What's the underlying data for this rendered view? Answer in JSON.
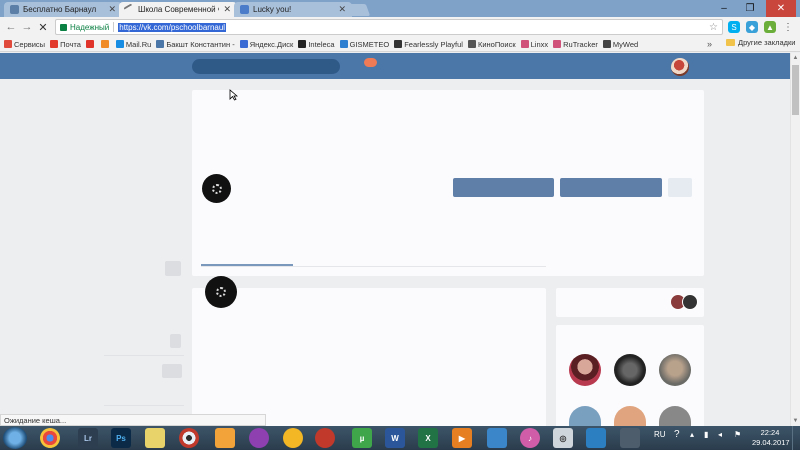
{
  "browser": {
    "tabs": [
      {
        "label": "Бесплатно Барнаул",
        "active": false
      },
      {
        "label": "Школа Современной Ф",
        "active": true
      },
      {
        "label": "Lucky you!",
        "active": false
      }
    ],
    "secure_label": "Надежный",
    "url": "https://vk.com/pschoolbarnaul",
    "bookmarks": [
      {
        "label": "Сервисы",
        "color": "#e04a3c"
      },
      {
        "label": "Почта",
        "color": "#e23b2e"
      },
      {
        "label": "",
        "color": "#e0342a"
      },
      {
        "label": "",
        "color": "#f08a24"
      },
      {
        "label": "Mail.Ru",
        "color": "#168de2"
      },
      {
        "label": "Бакшт Константин -",
        "color": "#4a76a8"
      },
      {
        "label": "Яндекс.Диск",
        "color": "#3a6bd5"
      },
      {
        "label": "Inteleca",
        "color": "#222222"
      },
      {
        "label": "GISMETEO",
        "color": "#2f7fd0"
      },
      {
        "label": "Fearlessly Playful",
        "color": "#333333"
      },
      {
        "label": "КиноПоиск",
        "color": "#555555"
      },
      {
        "label": "Linxx",
        "color": "#d0527a"
      },
      {
        "label": "RuTracker",
        "color": "#d0527a"
      },
      {
        "label": "MyWed",
        "color": "#444444"
      }
    ],
    "bookmarks_overflow": "»",
    "other_bookmarks": "Другие закладки",
    "status_text": "Ожидание кеша..."
  },
  "taskbar": {
    "lang": "RU",
    "time": "22:24",
    "date": "29.04.2017",
    "apps": [
      "chrome",
      "Lr",
      "Ps",
      "explorer",
      "eye",
      "paint",
      "vlc",
      "folder",
      "opera",
      "utorrent",
      "word",
      "excel",
      "media",
      "notes",
      "itunes",
      "camera",
      "monitor",
      "cards"
    ]
  }
}
